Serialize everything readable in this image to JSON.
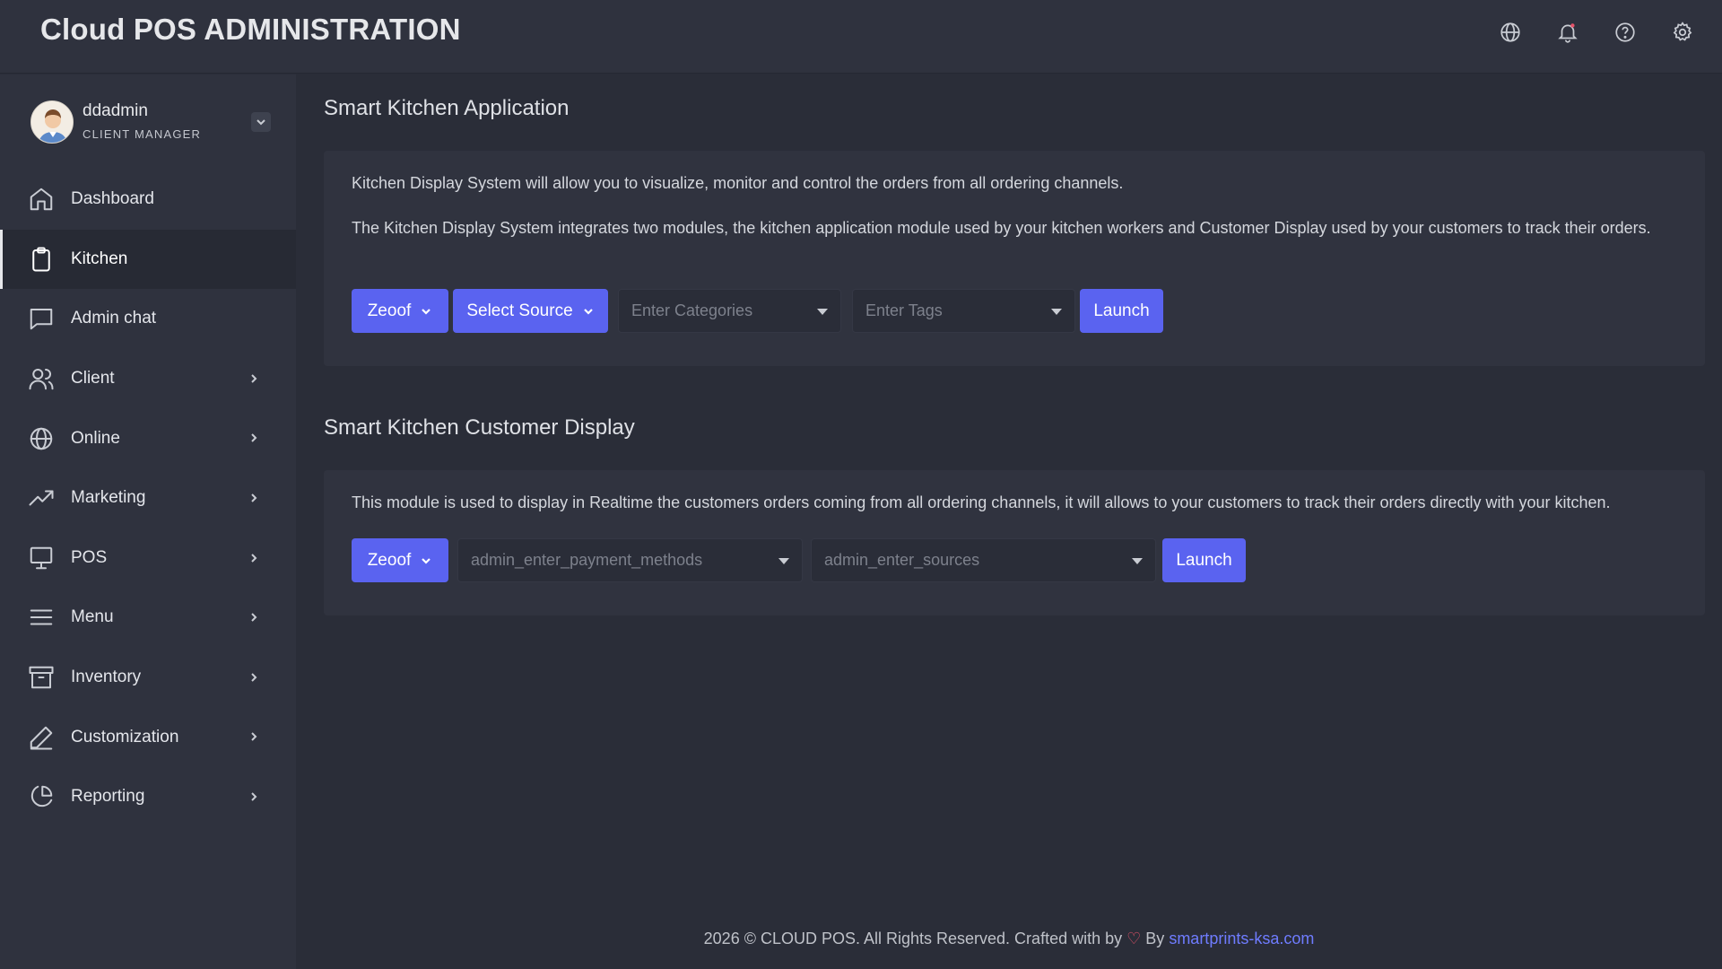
{
  "app": {
    "title": "Cloud POS ADMINISTRATION"
  },
  "topbar": {
    "icons": [
      "globe-icon",
      "bell-icon",
      "help-icon",
      "gear-icon"
    ]
  },
  "user": {
    "name": "ddadmin",
    "role": "CLIENT MANAGER"
  },
  "sidebar": {
    "items": [
      {
        "label": "Dashboard",
        "icon": "home-icon",
        "active": false,
        "has_children": false
      },
      {
        "label": "Kitchen",
        "icon": "clipboard-icon",
        "active": true,
        "has_children": false
      },
      {
        "label": "Admin chat",
        "icon": "chat-icon",
        "active": false,
        "has_children": false
      },
      {
        "label": "Client",
        "icon": "users-icon",
        "active": false,
        "has_children": true
      },
      {
        "label": "Online",
        "icon": "globe-icon",
        "active": false,
        "has_children": true
      },
      {
        "label": "Marketing",
        "icon": "trending-up-icon",
        "active": false,
        "has_children": true
      },
      {
        "label": "POS",
        "icon": "monitor-icon",
        "active": false,
        "has_children": true
      },
      {
        "label": "Menu",
        "icon": "menu-icon",
        "active": false,
        "has_children": true
      },
      {
        "label": "Inventory",
        "icon": "archive-icon",
        "active": false,
        "has_children": true
      },
      {
        "label": "Customization",
        "icon": "pen-icon",
        "active": false,
        "has_children": true
      },
      {
        "label": "Reporting",
        "icon": "pie-chart-icon",
        "active": false,
        "has_children": true
      }
    ]
  },
  "kitchen_app": {
    "title": "Smart Kitchen Application",
    "desc1": "Kitchen Display System will allow you to visualize, monitor and control the orders from all ordering channels.",
    "desc2": "The Kitchen Display System integrates two modules, the kitchen application module used by your kitchen workers and Customer Display used by your customers to track their orders.",
    "brand_button": "Zeoof",
    "source_button": "Select Source",
    "categories_placeholder": "Enter Categories",
    "tags_placeholder": "Enter Tags",
    "launch_label": "Launch"
  },
  "customer_display": {
    "title": "Smart Kitchen Customer Display",
    "desc": "This module is used to display in Realtime the customers orders coming from all ordering channels, it will allows to your customers to track their orders directly with your kitchen.",
    "brand_button": "Zeoof",
    "payment_placeholder": "admin_enter_payment_methods",
    "sources_placeholder": "admin_enter_sources",
    "launch_label": "Launch"
  },
  "footer": {
    "text": "2026 © CLOUD POS. All Rights Reserved. Crafted with by",
    "heart": "♡",
    "by": "By",
    "link": "smartprints-ksa.com"
  },
  "colors": {
    "accent": "#5a63f0",
    "link": "#6f7cff",
    "heart": "#e8536a"
  }
}
